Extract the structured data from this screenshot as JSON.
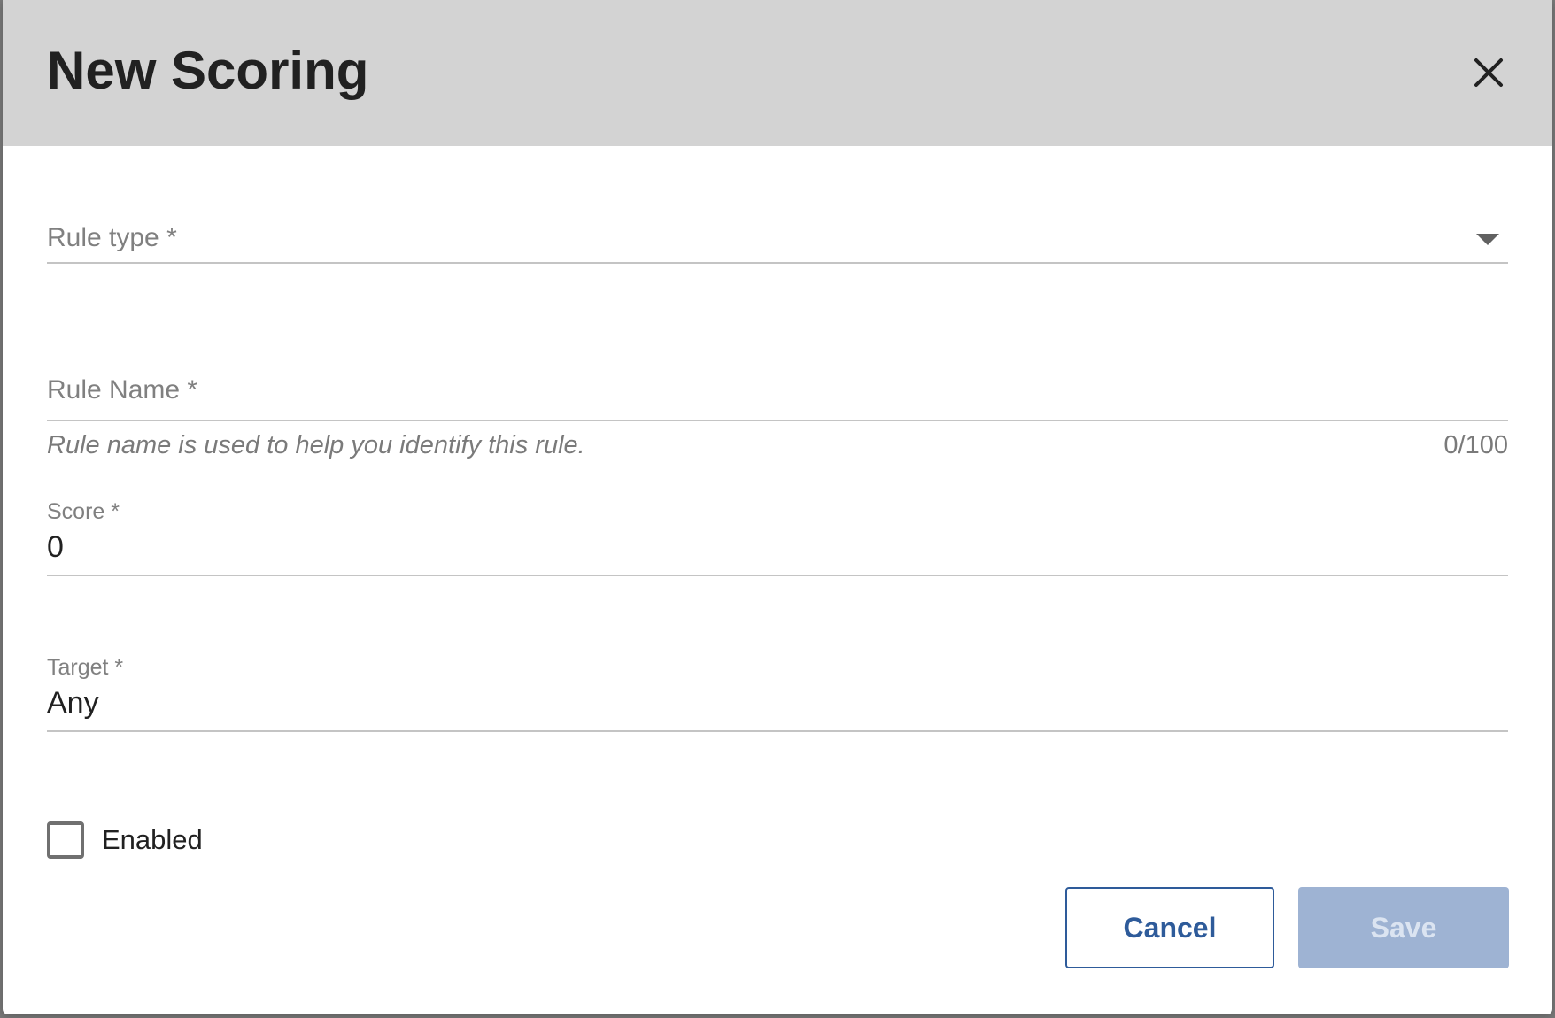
{
  "dialog": {
    "title": "New Scoring",
    "close_icon": "close-icon"
  },
  "form": {
    "rule_type": {
      "label": "Rule type *",
      "icon": "chevron-down-icon"
    },
    "rule_name": {
      "label": "Rule Name *",
      "helper": "Rule name is used to help you identify this rule.",
      "counter": "0/100"
    },
    "score": {
      "label": "Score *",
      "value": "0"
    },
    "target": {
      "label": "Target *",
      "value": "Any"
    },
    "enabled": {
      "label": "Enabled",
      "checked": false
    }
  },
  "actions": {
    "cancel_label": "Cancel",
    "save_label": "Save"
  },
  "colors": {
    "header_bg": "#d3d3d3",
    "primary": "#2e5b9a",
    "save_disabled_bg": "#9eb3d3"
  }
}
